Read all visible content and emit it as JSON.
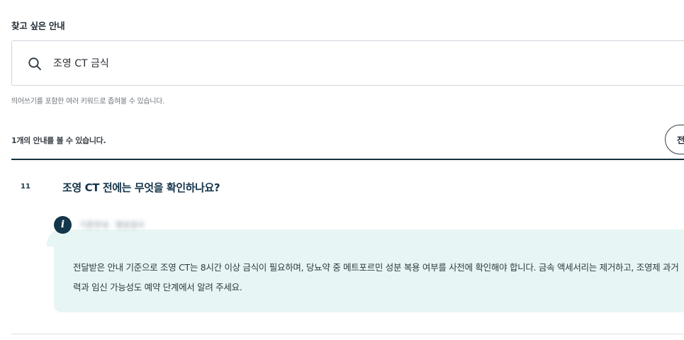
{
  "search": {
    "section_title": "찾고 싶은 안내",
    "query": "조영 CT 금식",
    "hint": "띄어쓰기를 포함한 여러 키워드로 좁혀볼 수 있습니다.",
    "icon": "search-icon"
  },
  "results": {
    "count_text": "1개의 안내를 볼 수 있습니다.",
    "view_all_label": "전체"
  },
  "items": [
    {
      "number": "11",
      "question": "조영 CT 전에는 무엇을 확인하나요?",
      "source_label": "기준안내 · 영상검사",
      "info_icon": "i",
      "answer": "전달받은 안내 기준으로 조영 CT는 8시간 이상 금식이 필요하며, 당뇨약 중 메트포르민 성분 복용 여부를 사전에 확인해야 합니다. 금속 액세서리는 제거하고, 조영제 과거력과 임신 가능성도 예약 단계에서 알려 주세요."
    }
  ],
  "colors": {
    "accent_dark": "#13364a",
    "answer_bg": "#e7f6f4",
    "divider": "#14313e"
  }
}
